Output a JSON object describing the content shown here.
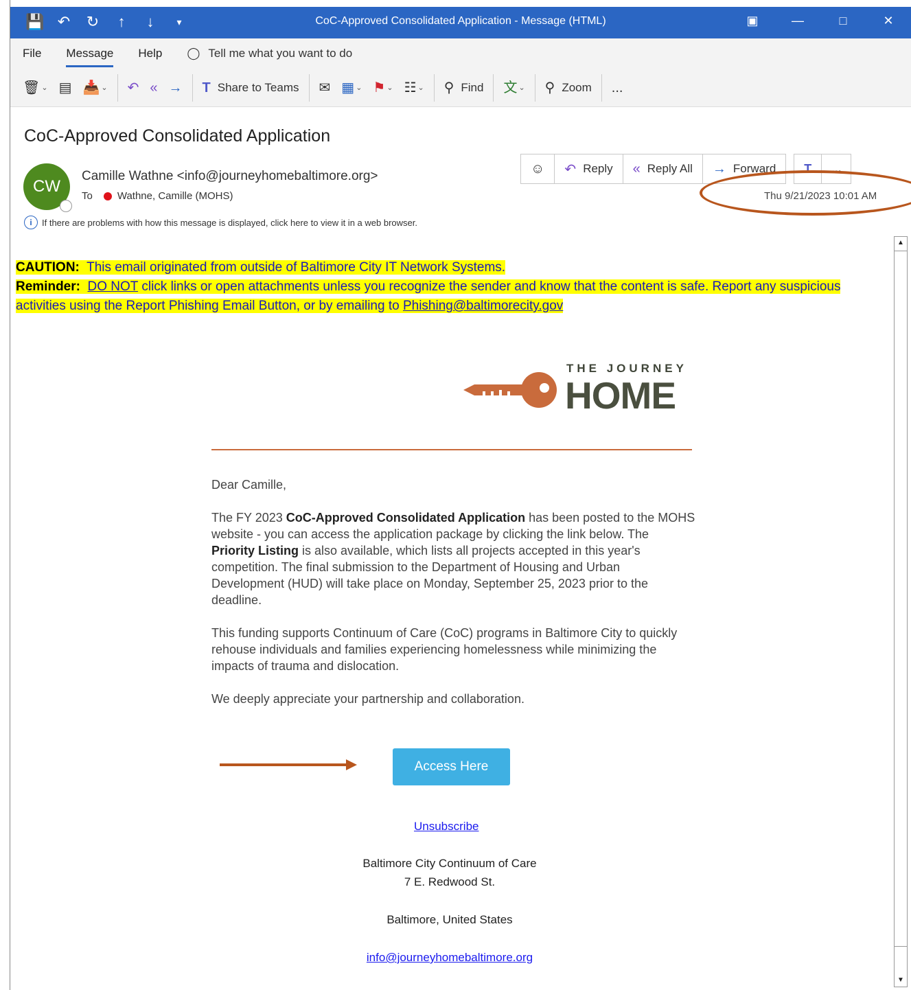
{
  "window": {
    "title": "CoC-Approved Consolidated Application  -  Message (HTML)",
    "quick_access": [
      "save-icon",
      "undo-icon",
      "redo-icon",
      "up-icon",
      "down-icon",
      "customize-icon"
    ]
  },
  "menu": {
    "items": [
      "File",
      "Message",
      "Help"
    ],
    "tell_me": "Tell me what you want to do"
  },
  "ribbon": {
    "share_to_teams": "Share to Teams",
    "find": "Find",
    "zoom": "Zoom",
    "more": "..."
  },
  "message": {
    "subject": "CoC-Approved Consolidated Application",
    "avatar_initials": "CW",
    "sender": "Camille Wathne <info@journeyhomebaltimore.org>",
    "to_label": "To",
    "to_name": "Wathne, Camille (MOHS)",
    "info_text": "If there are problems with how this message is displayed, click here to view it in a web browser.",
    "date": "Thu 9/21/2023 10:01 AM",
    "actions": {
      "reply": "Reply",
      "reply_all": "Reply All",
      "forward": "Forward",
      "more": "..."
    }
  },
  "caution": {
    "label": "CAUTION:",
    "text": "This email originated from outside of Baltimore City IT Network Systems.",
    "reminder_label": "Reminder:",
    "do_not": "DO NOT",
    "reminder_text": "click links or open attachments unless you recognize the sender and know that the content is safe.  Report any suspicious activities using the Report Phishing Email Button, or by emailing to",
    "phishing_email": "Phishing@baltimorecity.gov"
  },
  "logo": {
    "the_journey": "THE JOURNEY",
    "home": "HOME"
  },
  "body": {
    "greeting": "Dear Camille,",
    "p1_a": "The FY 2023 ",
    "p1_b": "CoC-Approved Consolidated Application",
    "p1_c": " has been posted to the MOHS website - you can access the application package by clicking the link below. The ",
    "p1_d": "Priority Listing",
    "p1_e": " is also available, which lists all projects accepted in this year's competition. The final submission to the Department of Housing and Urban Development (HUD) will take place on Monday, September 25, 2023 prior to the deadline.",
    "p2": "This funding supports Continuum of Care (CoC) programs in Baltimore City to quickly rehouse individuals and families experiencing homelessness while minimizing the impacts of trauma and dislocation.",
    "p3": "We deeply appreciate your partnership and collaboration.",
    "button": "Access Here",
    "unsubscribe": "Unsubscribe",
    "footer_org": "Baltimore City Continuum of Care",
    "footer_street": "7 E. Redwood St.",
    "footer_city": "Baltimore, United States",
    "footer_email": "info@journeyhomebaltimore.org"
  },
  "colors": {
    "titlebar": "#2b66c3",
    "annotation": "#b8561d",
    "button": "#3fb0e3",
    "caution_highlight": "#ffff00"
  }
}
